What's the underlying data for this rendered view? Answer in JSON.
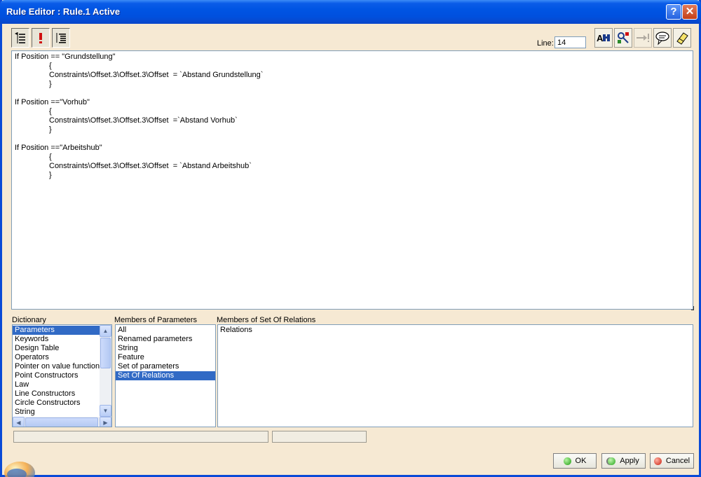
{
  "window": {
    "title": "Rule Editor : Rule.1 Active"
  },
  "titlebar": {
    "help_glyph": "?",
    "close_glyph": "✕"
  },
  "toolbar": {
    "line_label": "Line:",
    "line_value": "14",
    "left_icons": [
      "tree-view-icon",
      "exclamation-icon",
      "outline-icon"
    ],
    "right_icons": [
      "find-icon",
      "object-browser-icon",
      "goto-icon",
      "comment-icon",
      "eraser-icon"
    ]
  },
  "editor": {
    "lines": [
      "If Position == \"Grundstellung\"",
      "{",
      "Constraints\\Offset.3\\Offset.3\\Offset  = `Abstand Grundstellung`",
      "}",
      "If Position ==\"Vorhub\"",
      "{",
      "Constraints\\Offset.3\\Offset.3\\Offset  =`Abstand Vorhub`",
      "}",
      "If Position ==\"Arbeitshub\"",
      "{",
      "Constraints\\Offset.3\\Offset.3\\Offset  = `Abstand Arbeitshub`",
      "}"
    ]
  },
  "dictionary": {
    "label": "Dictionary",
    "items": [
      "Parameters",
      "Keywords",
      "Design Table",
      "Operators",
      "Pointer on value functions",
      "Point Constructors",
      "Law",
      "Line Constructors",
      "Circle Constructors",
      "String"
    ],
    "selected": "Parameters"
  },
  "members": {
    "label": "Members of Parameters",
    "items": [
      "All",
      "Renamed parameters",
      "String",
      "Feature",
      "Set of parameters",
      "Set Of Relations"
    ],
    "selected": "Set Of Relations"
  },
  "members_of_set": {
    "label": "Members of Set Of Relations",
    "items": [
      "Relations"
    ]
  },
  "buttons": {
    "ok": "OK",
    "apply": "Apply",
    "cancel": "Cancel"
  },
  "colors": {
    "title_blue": "#0054e3",
    "window_bg": "#f6e9d3",
    "selection": "#316ac5"
  }
}
